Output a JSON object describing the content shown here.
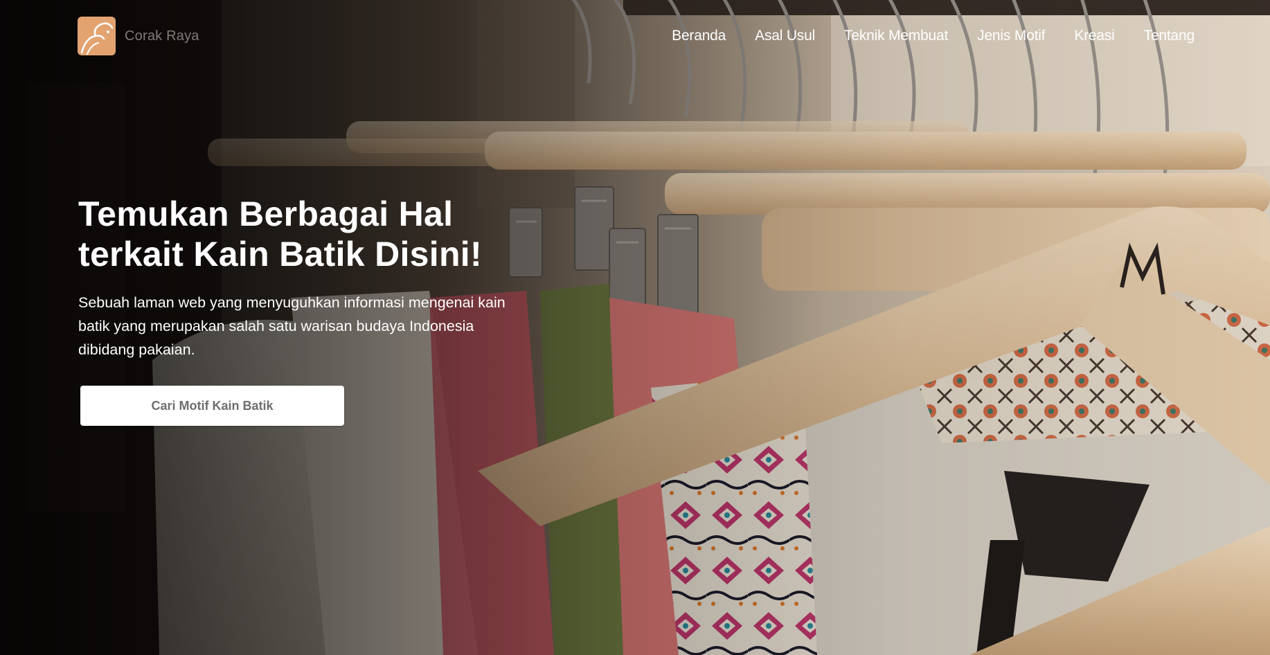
{
  "brand": {
    "name": "Corak Raya",
    "logo_icon": "batik-swirl-icon",
    "logo_color": "#e2a371"
  },
  "nav": {
    "items": [
      {
        "label": "Beranda"
      },
      {
        "label": "Asal Usul"
      },
      {
        "label": "Teknik Membuat"
      },
      {
        "label": "Jenis Motif"
      },
      {
        "label": "Kreasi"
      },
      {
        "label": "Tentang"
      }
    ]
  },
  "hero": {
    "title_line1": "Temukan Berbagai Hal",
    "title_line2": "terkait Kain Batik Disini!",
    "description_line1": "Sebuah laman web yang menyuguhkan informasi mengenai kain",
    "description_line2": "batik yang merupakan salah satu warisan budaya Indonesia",
    "description_line3": "dibidang pakaian.",
    "cta_label": "Cari Motif Kain Batik",
    "background_image": "clothes-on-hangers-photo"
  },
  "colors": {
    "text_primary": "#ffffff",
    "button_bg": "#ffffff",
    "button_text": "#6e6e6e",
    "brand_text": "#7f7b78"
  }
}
